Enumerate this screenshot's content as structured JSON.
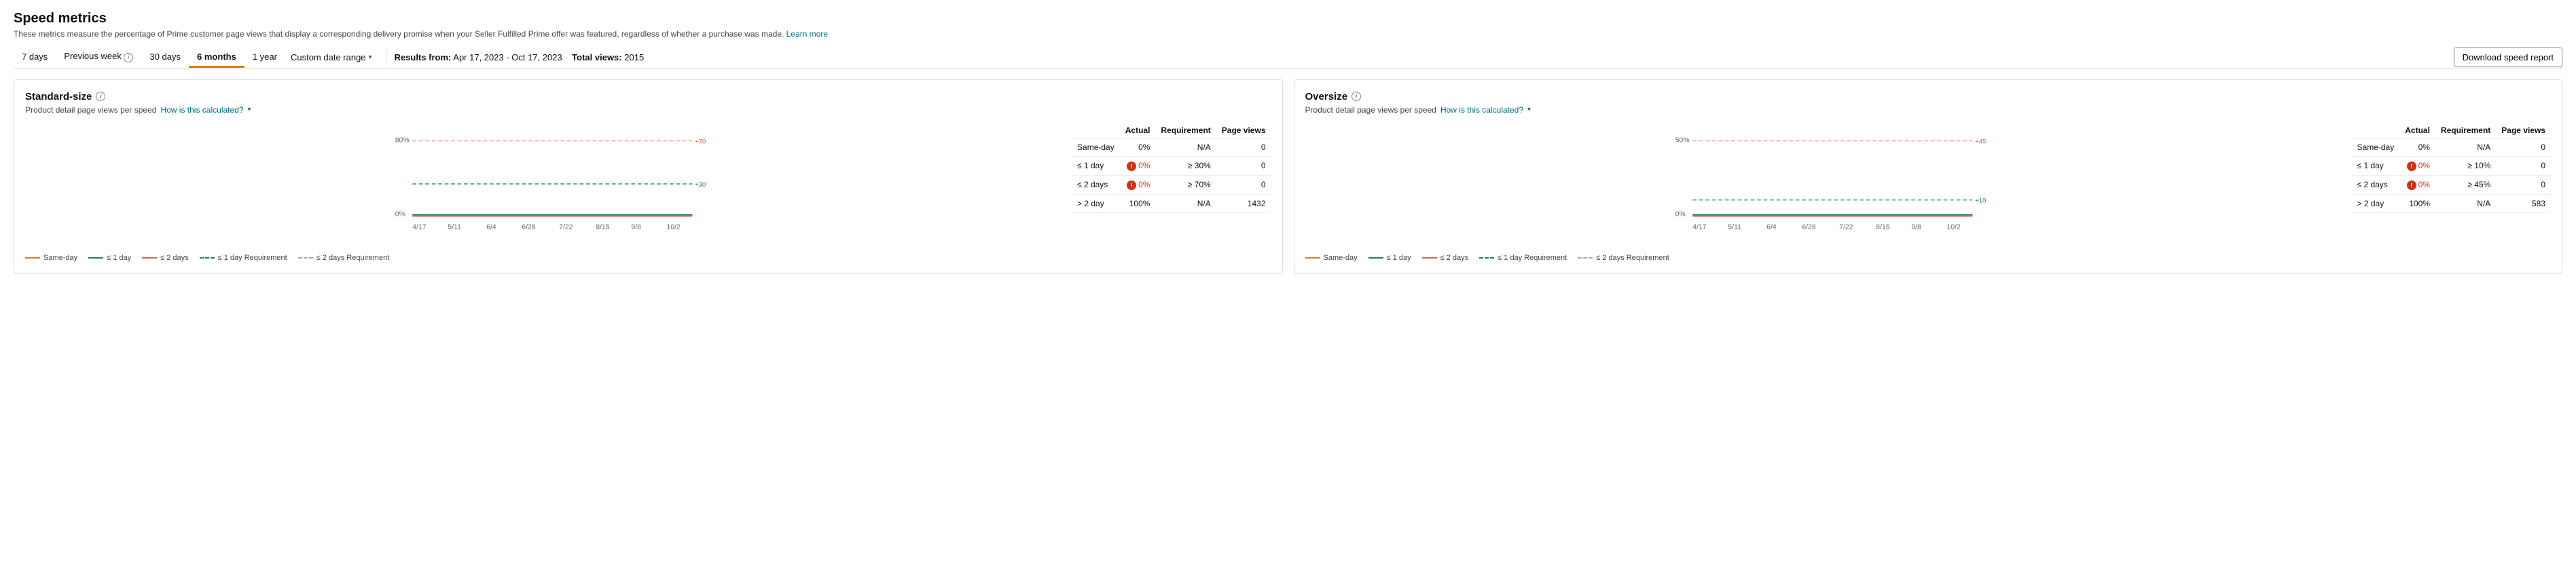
{
  "page": {
    "title": "Speed metrics",
    "subtitle": "These metrics measure the percentage of Prime customer page views that display a corresponding delivery promise when your Seller Fulfilled Prime offer was featured, regardless of whether a purchase was made.",
    "learn_more": "Learn more"
  },
  "toolbar": {
    "tabs": [
      {
        "label": "7 days",
        "active": false
      },
      {
        "label": "Previous week",
        "active": false,
        "has_info": true
      },
      {
        "label": "30 days",
        "active": false
      },
      {
        "label": "6 months",
        "active": true
      },
      {
        "label": "1 year",
        "active": false
      }
    ],
    "custom_date_range": "Custom date range",
    "results_from_label": "Results from:",
    "results_from_value": "Apr 17, 2023 - Oct 17, 2023",
    "total_views_label": "Total views:",
    "total_views_value": "2015",
    "download_label": "Download speed report"
  },
  "standard_panel": {
    "title": "Standard-size",
    "chart_sublabel": "Product detail page views per speed",
    "how_calculated": "How is this calculated?",
    "chart": {
      "x_labels": [
        "4/17",
        "5/11",
        "6/4",
        "6/28",
        "7/22",
        "8/15",
        "9/8",
        "10/2"
      ],
      "y_labels_left": [
        "80%",
        "0%"
      ],
      "requirement_labels": [
        "+70",
        "+30"
      ],
      "colors": {
        "same_day": "#e47911",
        "le1day": "#1a7f5a",
        "le2day": "#e55",
        "le1day_req": "#1a7f5a",
        "le2day_req": "#aaa"
      }
    },
    "legend": [
      {
        "label": "Same-day",
        "type": "arrow",
        "color": "#e47911"
      },
      {
        "label": "≤ 1 day",
        "type": "arrow",
        "color": "#1a7f5a"
      },
      {
        "label": "≤ 2 days",
        "type": "arrow",
        "color": "#e55"
      },
      {
        "label": "≤ 1 day Requirement",
        "type": "dash",
        "color": "#1a7f5a"
      },
      {
        "label": "≤ 2 days Requirement",
        "type": "dash",
        "color": "#aaa"
      }
    ],
    "table": {
      "headers": [
        "",
        "Actual",
        "Requirement",
        "Page views"
      ],
      "rows": [
        {
          "label": "Same-day",
          "actual": "0%",
          "requirement": "N/A",
          "page_views": "0",
          "error": false
        },
        {
          "label": "≤ 1 day",
          "actual": "0%",
          "requirement": "≥ 30%",
          "page_views": "0",
          "error": true
        },
        {
          "label": "≤ 2 days",
          "actual": "0%",
          "requirement": "≥ 70%",
          "page_views": "0",
          "error": true
        },
        {
          "label": "> 2 day",
          "actual": "100%",
          "requirement": "N/A",
          "page_views": "1432",
          "error": false
        }
      ]
    }
  },
  "oversize_panel": {
    "title": "Oversize",
    "chart_sublabel": "Product detail page views per speed",
    "how_calculated": "How is this calculated?",
    "chart": {
      "x_labels": [
        "4/17",
        "5/11",
        "6/4",
        "6/28",
        "7/22",
        "8/15",
        "9/8",
        "10/2"
      ],
      "y_labels_left": [
        "50%",
        "0%"
      ],
      "requirement_labels": [
        "+45",
        "+10"
      ]
    },
    "legend": [
      {
        "label": "Same-day",
        "type": "arrow",
        "color": "#e47911"
      },
      {
        "label": "≤ 1 day",
        "type": "arrow",
        "color": "#1a7f5a"
      },
      {
        "label": "≤ 2 days",
        "type": "arrow",
        "color": "#e55"
      },
      {
        "label": "≤ 1 day Requirement",
        "type": "dash",
        "color": "#1a7f5a"
      },
      {
        "label": "≤ 2 days Requirement",
        "type": "dash",
        "color": "#aaa"
      }
    ],
    "table": {
      "headers": [
        "",
        "Actual",
        "Requirement",
        "Page views"
      ],
      "rows": [
        {
          "label": "Same-day",
          "actual": "0%",
          "requirement": "N/A",
          "page_views": "0",
          "error": false
        },
        {
          "label": "≤ 1 day",
          "actual": "0%",
          "requirement": "≥ 10%",
          "page_views": "0",
          "error": true
        },
        {
          "label": "≤ 2 days",
          "actual": "0%",
          "requirement": "≥ 45%",
          "page_views": "0",
          "error": true
        },
        {
          "label": "> 2 day",
          "actual": "100%",
          "requirement": "N/A",
          "page_views": "583",
          "error": false
        }
      ]
    }
  }
}
